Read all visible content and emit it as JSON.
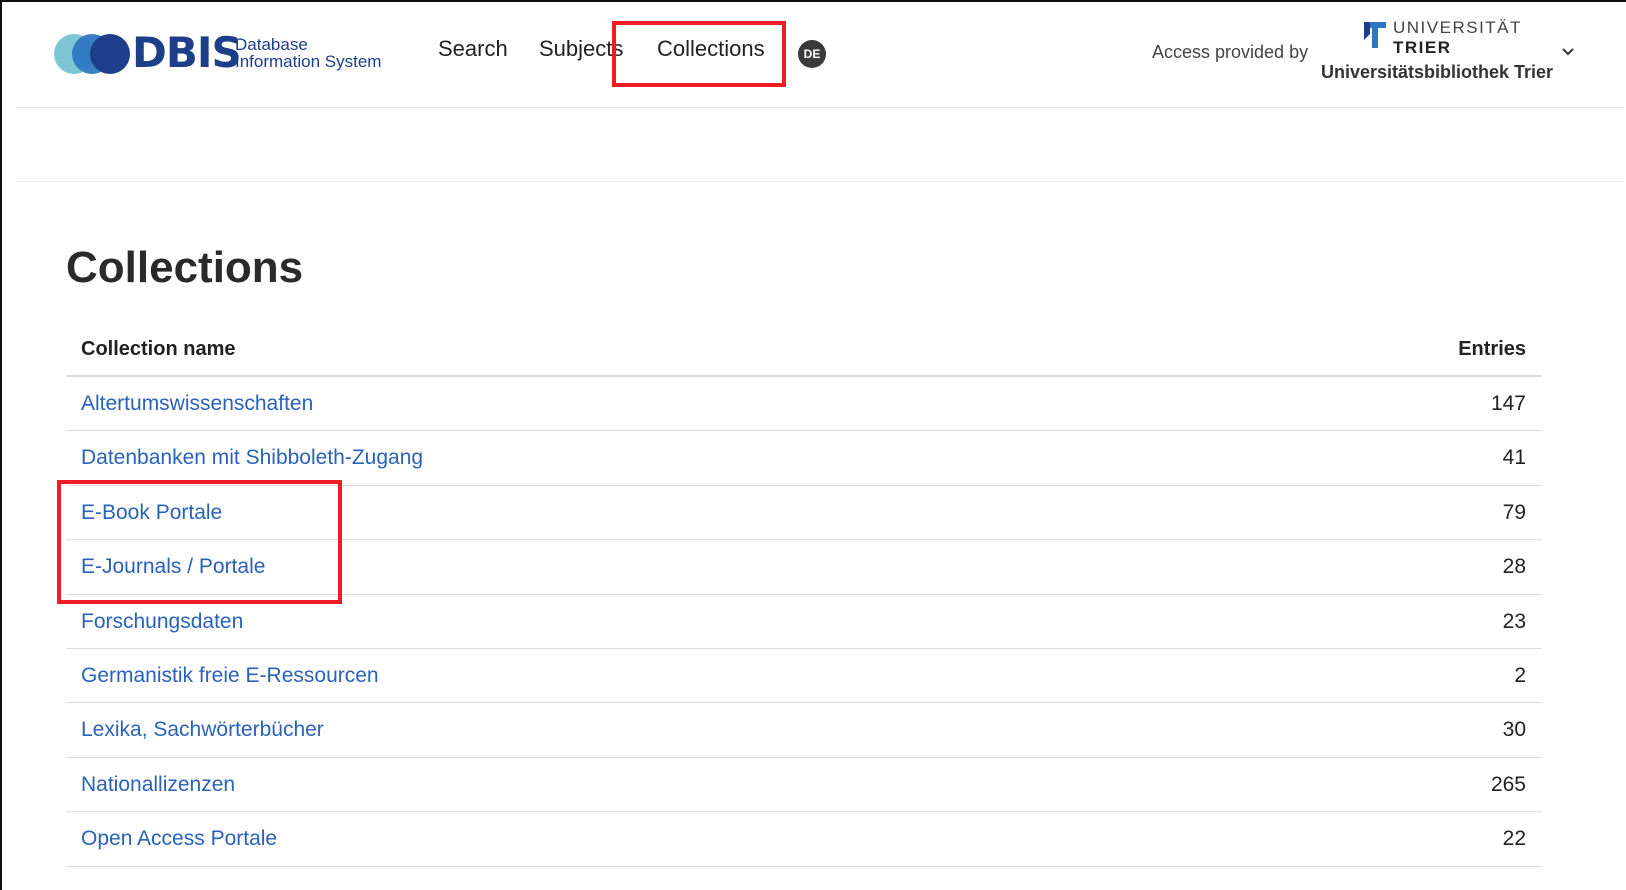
{
  "header": {
    "logo_word": "DBIS",
    "logo_sub_line1": "Database",
    "logo_sub_line2": "Information System",
    "nav": {
      "search": "Search",
      "subjects": "Subjects",
      "collections": "Collections"
    },
    "lang_toggle": "DE",
    "access_label": "Access provided by",
    "university_line1": "UNIVERSITÄT",
    "university_line2": "TRIER",
    "library_name": "Universitätsbibliothek Trier"
  },
  "main": {
    "title": "Collections",
    "table": {
      "headers": {
        "name": "Collection name",
        "entries": "Entries"
      },
      "rows": [
        {
          "name": "Altertumswissenschaften",
          "entries": "147"
        },
        {
          "name": "Datenbanken mit Shibboleth-Zugang",
          "entries": "41"
        },
        {
          "name": "E-Book Portale",
          "entries": "79"
        },
        {
          "name": "E-Journals / Portale",
          "entries": "28"
        },
        {
          "name": "Forschungsdaten",
          "entries": "23"
        },
        {
          "name": "Germanistik freie E-Ressourcen",
          "entries": "2"
        },
        {
          "name": "Lexika, Sachwörterbücher",
          "entries": "30"
        },
        {
          "name": "Nationallizenzen",
          "entries": "265"
        },
        {
          "name": "Open Access Portale",
          "entries": "22"
        }
      ]
    }
  },
  "colors": {
    "link": "#2a62b8",
    "brand_dark": "#1d3f8a",
    "highlight": "#ee1c24"
  }
}
